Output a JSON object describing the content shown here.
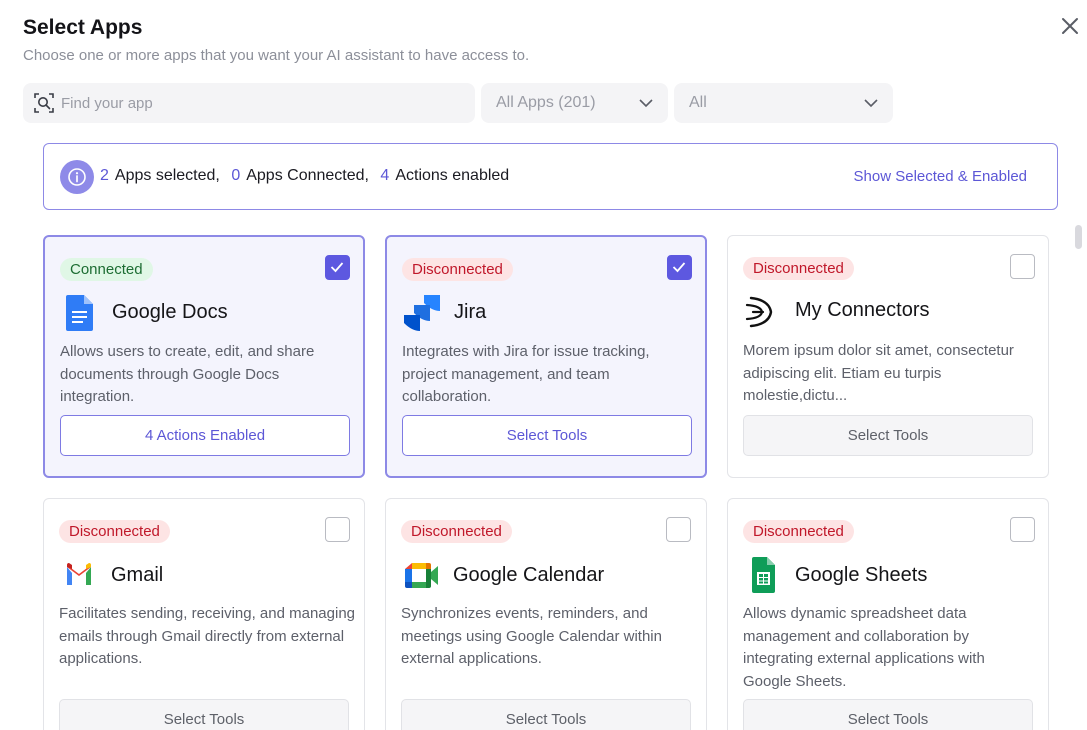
{
  "dialog": {
    "title": "Select Apps",
    "subtitle": "Choose one or more apps that you want your AI assistant to have access to."
  },
  "filters": {
    "search_placeholder": "Find your app",
    "category_dropdown": "All Apps (201)",
    "status_dropdown": "All"
  },
  "summary": {
    "apps_selected_count": "2",
    "apps_selected_label": "Apps selected,",
    "apps_connected_count": "0",
    "apps_connected_label": "Apps Connected,",
    "actions_enabled_count": "4",
    "actions_enabled_label": "Actions enabled",
    "show_selected_link": "Show Selected & Enabled"
  },
  "colors": {
    "accent": "#5c57d6",
    "connected_bg": "#e0f7e6",
    "disconnected_bg": "#fde4e4"
  },
  "apps": [
    {
      "name": "Google Docs",
      "status": "Connected",
      "selected": true,
      "icon": "google-docs-icon",
      "description": "Allows users to create, edit, and share documents through Google Docs integration.",
      "action_label": "4 Actions Enabled"
    },
    {
      "name": "Jira",
      "status": "Disconnected",
      "selected": true,
      "icon": "jira-icon",
      "description": "Integrates with Jira for issue tracking, project management, and team collaboration.",
      "action_label": "Select Tools"
    },
    {
      "name": "My Connectors",
      "status": "Disconnected",
      "selected": false,
      "icon": "my-connectors-icon",
      "description": "Morem ipsum dolor sit amet, consectetur adipiscing elit. Etiam eu turpis molestie,dictu...",
      "action_label": "Select Tools"
    },
    {
      "name": "Gmail",
      "status": "Disconnected",
      "selected": false,
      "icon": "gmail-icon",
      "description": "Facilitates sending, receiving, and managing emails through Gmail directly from external applications.",
      "action_label": "Select Tools"
    },
    {
      "name": "Google Calendar",
      "status": "Disconnected",
      "selected": false,
      "icon": "google-calendar-icon",
      "description": "Synchronizes events, reminders, and meetings using Google Calendar within external applications.",
      "action_label": "Select Tools"
    },
    {
      "name": "Google Sheets",
      "status": "Disconnected",
      "selected": false,
      "icon": "google-sheets-icon",
      "description": "Allows dynamic spreadsheet data management and collaboration by integrating external applications with Google Sheets.",
      "action_label": "Select Tools"
    }
  ]
}
